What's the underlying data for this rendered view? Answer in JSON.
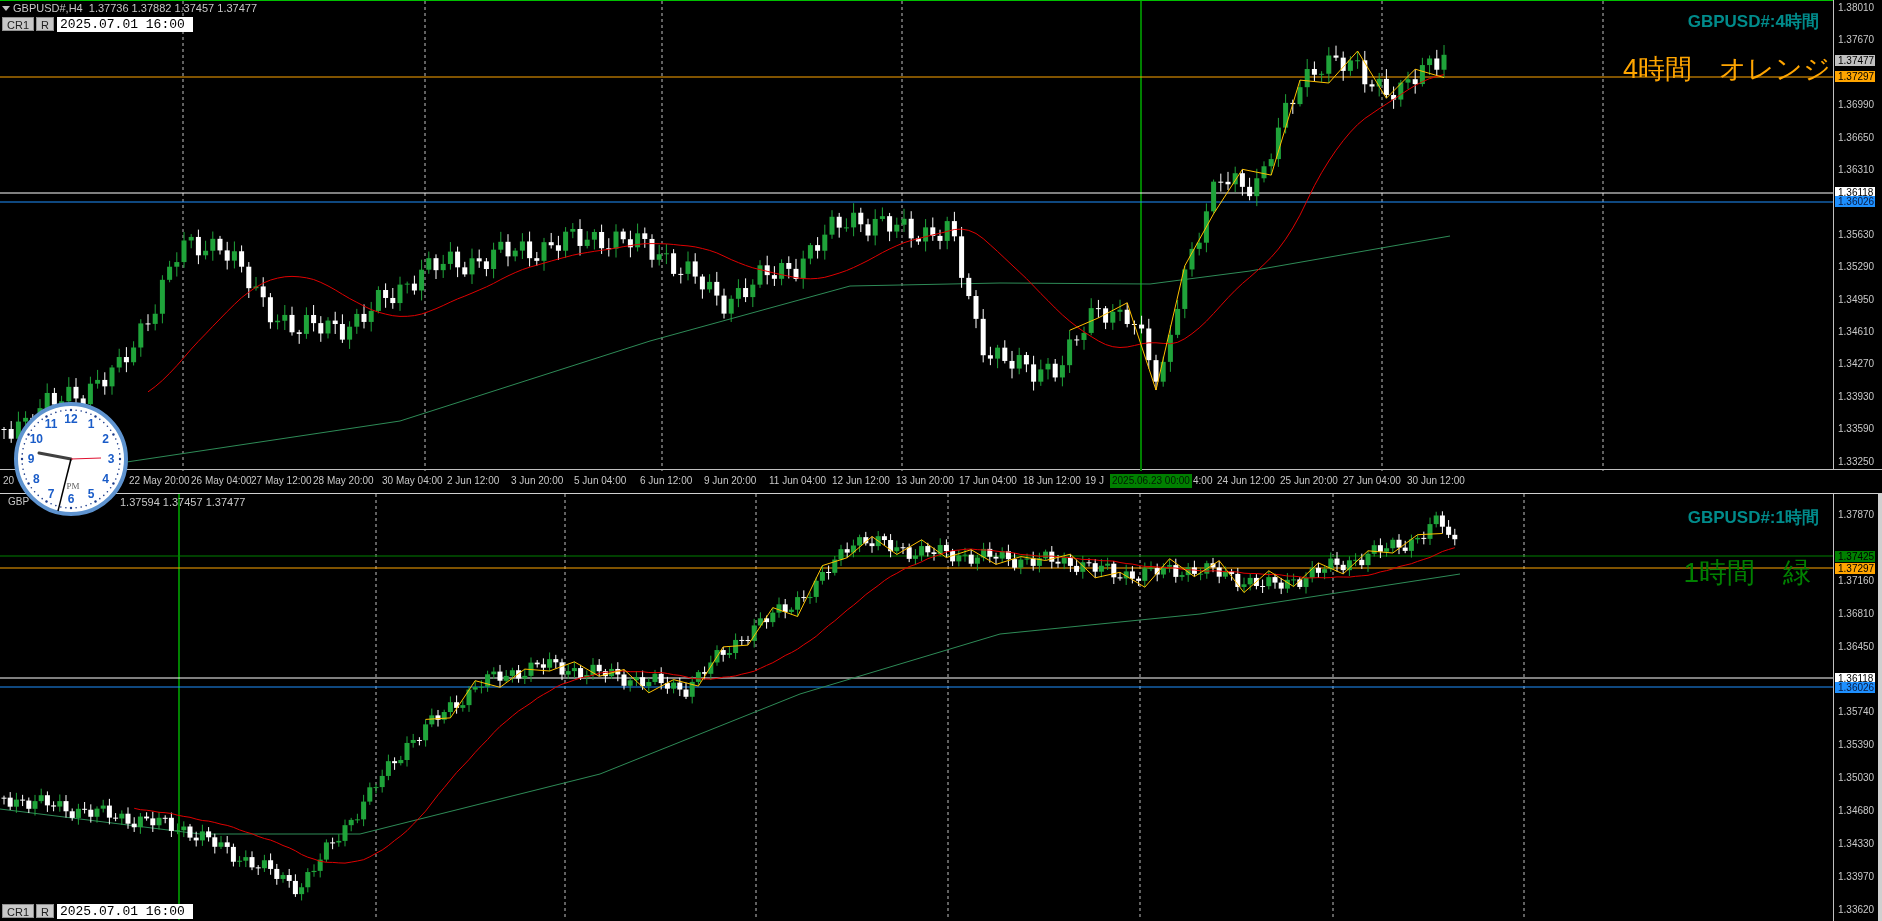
{
  "top_chart": {
    "header": "GBPUSD#,H4  1.37736 1.37882 1.37457 1.37477",
    "buttons": [
      "CR1",
      "R"
    ],
    "date_field": "2025.07.01 16:00",
    "title": "GBPUSD#:4時間",
    "note": "4時間　オレンジ",
    "price_axis": [
      "1.38010",
      "1.37670",
      "1.36990",
      "1.36650",
      "1.36310",
      "1.35630",
      "1.35290",
      "1.34950",
      "1.34610",
      "1.34270",
      "1.33930",
      "1.33590",
      "1.33250"
    ],
    "price_tags": [
      {
        "value": "1.37477",
        "color": "#c0c0c0"
      },
      {
        "value": "1.37297",
        "color": "#ffa500",
        "line": true
      },
      {
        "value": "1.36118",
        "color": "#ffffff",
        "line": true
      },
      {
        "value": "1.36026",
        "color": "#1e90ff",
        "line": true
      }
    ],
    "time_axis": [
      "20",
      "22 May 20:00",
      "26 May 04:00",
      "27 May 12:00",
      "28 May 20:00",
      "30 May 04:00",
      "2 Jun 12:00",
      "3 Jun 20:00",
      "5 Jun 04:00",
      "6 Jun 12:00",
      "9 Jun 20:00",
      "11 Jun 04:00",
      "12 Jun 12:00",
      "13 Jun 20:00",
      "17 Jun 04:00",
      "18 Jun 12:00",
      "19 J",
      "4:00",
      "24 Jun 12:00",
      "25 Jun 20:00",
      "27 Jun 04:00",
      "30 Jun 12:00"
    ],
    "cursor_time": "2025.06.23 00:00"
  },
  "bottom_chart": {
    "header_left": "GBP",
    "header_right": "1.37594 1.37457 1.37477",
    "buttons": [
      "CR1",
      "R"
    ],
    "date_field": "2025.07.01 16:00",
    "title": "GBPUSD#:1時間",
    "note": "1時間　緑",
    "price_axis": [
      "1.37870",
      "1.37160",
      "1.36810",
      "1.36450",
      "1.35740",
      "1.35390",
      "1.35030",
      "1.34680",
      "1.34330",
      "1.33970",
      "1.33620"
    ],
    "price_tags": [
      {
        "value": "1.37425",
        "color": "#008000",
        "line": true
      },
      {
        "value": "1.37297",
        "color": "#ffa500",
        "line": true
      },
      {
        "value": "1.36118",
        "color": "#ffffff",
        "line": true
      },
      {
        "value": "1.36026",
        "color": "#1e90ff",
        "line": true
      }
    ]
  },
  "clock": {
    "numerals": [
      "12",
      "11",
      "1",
      "10",
      "2",
      "9",
      "3",
      "8",
      "4",
      "7",
      "5",
      "6"
    ],
    "period": "PM"
  }
}
